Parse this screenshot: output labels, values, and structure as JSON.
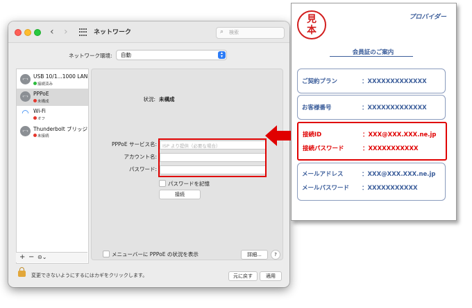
{
  "window": {
    "title": "ネットワーク",
    "search_placeholder": "検索",
    "location_label": "ネットワーク環境:",
    "location_value": "自動"
  },
  "sidebar": {
    "services": [
      {
        "name": "USB 10/1...1000 LAN",
        "status": "接続済み",
        "status_color": "#2dbc3e",
        "icon": "ethernet-icon"
      },
      {
        "name": "PPPoE",
        "status": "未構成",
        "status_color": "#e5372d",
        "icon": "ethernet-icon"
      },
      {
        "name": "Wi-Fi",
        "status": "オフ",
        "status_color": "#e5372d",
        "icon": "wifi-icon"
      },
      {
        "name": "Thunderbolt ブリッジ",
        "status": "未接続",
        "status_color": "#e5372d",
        "icon": "ethernet-icon"
      }
    ],
    "tools": {
      "add": "+",
      "remove": "−",
      "more": "⊝⌄"
    }
  },
  "detail": {
    "status_label": "状況:",
    "status_value": "未構成",
    "service_name_label": "PPPoE サービス名:",
    "service_name_placeholder": "ISP より提供（必要な場合）",
    "account_label": "アカウント名:",
    "password_label": "パスワード:",
    "remember_password": "パスワードを記憶",
    "connect_button": "接続",
    "show_menubar_status": "メニューバーに PPPoE の状況を表示",
    "advanced_button": "詳細...",
    "help_button": "?"
  },
  "footer": {
    "lock_text": "変更できないようにするにはカギをクリックします。",
    "revert_button": "元に戻す",
    "apply_button": "適用"
  },
  "card": {
    "stamp_top": "見",
    "stamp_bottom": "本",
    "provider": "プロバイダー",
    "title": "会員証のご案内",
    "plan_label": "ご契約プラン",
    "plan_value": "：XXXXXXXXXXXXX",
    "customer_label": "お客様番号",
    "customer_value": "：XXXXXXXXXXXXX",
    "conn_id_label": "接続ID",
    "conn_id_value": "：XXX@XXX.XXX.ne.jp",
    "conn_pw_label": "接続パスワード",
    "conn_pw_value": "：XXXXXXXXXXX",
    "mail_label": "メールアドレス",
    "mail_value": "：XXX@XXX.XXX.ne.jp",
    "mail_pw_label": "メールパスワード",
    "mail_pw_value": "：XXXXXXXXXXX"
  },
  "colors": {
    "highlight": "#e00000",
    "card_text": "#3b5d9a",
    "accent": "#2d7cf6"
  }
}
